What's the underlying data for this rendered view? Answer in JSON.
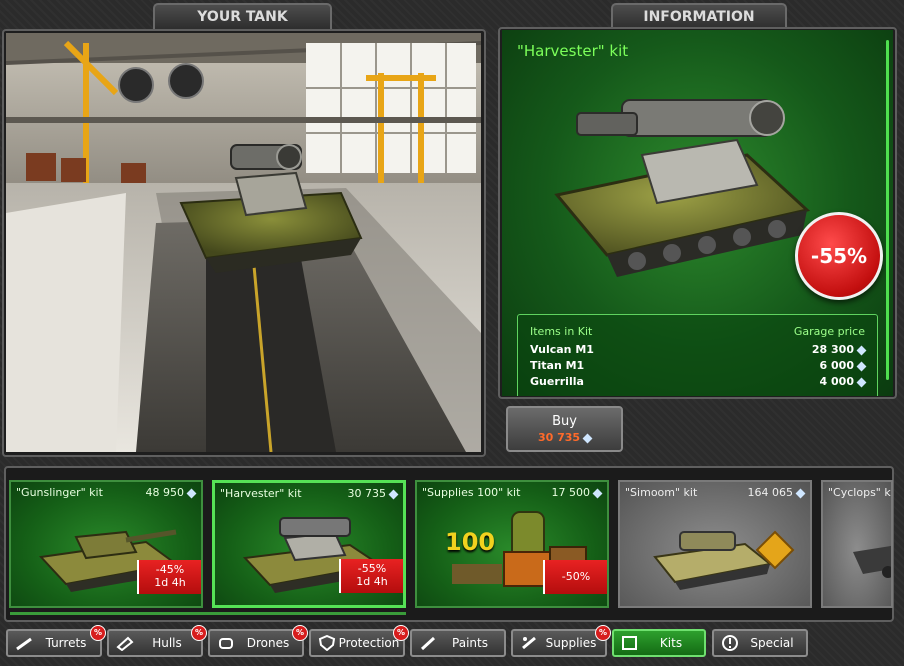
{
  "tabs": {
    "your_tank": "YOUR TANK",
    "information": "INFORMATION"
  },
  "info": {
    "title": "\"Harvester\" kit",
    "discount": "-55%",
    "table": {
      "col_items": "Items in Kit",
      "col_price": "Garage price",
      "rows": [
        {
          "name": "Vulcan M1",
          "price": "28 300"
        },
        {
          "name": "Titan M1",
          "price": "6 000"
        },
        {
          "name": "Guerrilla",
          "price": "4 000"
        }
      ]
    }
  },
  "buy": {
    "label": "Buy",
    "price": "30 735"
  },
  "cards": [
    {
      "name": "\"Gunslinger\" kit",
      "price": "48 950",
      "discount": "-45%",
      "timer": "1d 4h"
    },
    {
      "name": "\"Harvester\" kit",
      "price": "30 735",
      "discount": "-55%",
      "timer": "1d 4h"
    },
    {
      "name": "\"Supplies 100\" kit",
      "price": "17 500",
      "discount": "-50%",
      "overlay_number": "100"
    },
    {
      "name": "\"Simoom\" kit",
      "price": "164 065"
    },
    {
      "name": "\"Cyclops\" kit"
    }
  ],
  "categories": [
    {
      "label": "Turrets",
      "icon": "turret-icon",
      "sale": true
    },
    {
      "label": "Hulls",
      "icon": "hull-icon",
      "sale": true
    },
    {
      "label": "Drones",
      "icon": "drone-icon",
      "sale": true
    },
    {
      "label": "Protection",
      "icon": "shield-icon",
      "sale": true
    },
    {
      "label": "Paints",
      "icon": "paint-brush-icon",
      "sale": false
    },
    {
      "label": "Supplies",
      "icon": "supplies-icon",
      "sale": true
    },
    {
      "label": "Kits",
      "icon": "kits-icon",
      "sale": false,
      "active": true
    },
    {
      "label": "Special",
      "icon": "exclamation-icon",
      "sale": false
    }
  ],
  "sale_badge": "%",
  "colors": {
    "accent_green": "#2ea02e",
    "discount_red": "#d71d1d",
    "crystal": "#cfe6ff"
  }
}
